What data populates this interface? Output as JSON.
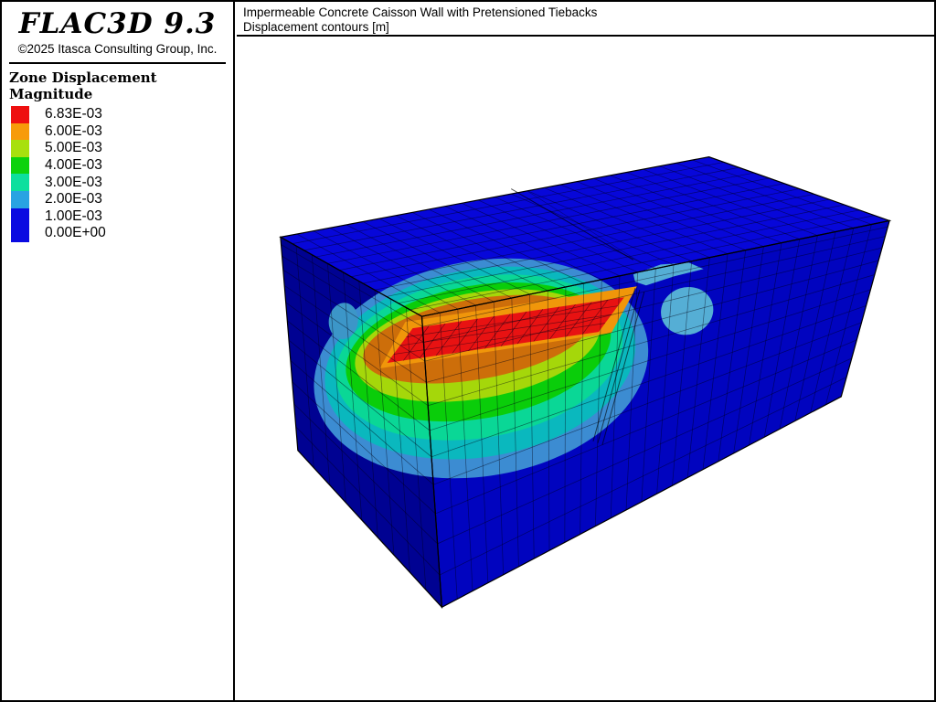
{
  "logo": {
    "title": "FLAC3D 9.3",
    "copyright": "©2025 Itasca Consulting Group, Inc."
  },
  "header": {
    "line1": "Impermeable Concrete Caisson Wall with Pretensioned Tiebacks",
    "line2": "Displacement contours [m]"
  },
  "legend": {
    "title": "Zone Displacement Magnitude",
    "entries": [
      {
        "label": "6.83E-03",
        "color": "#ee1010"
      },
      {
        "label": "6.00E-03",
        "color": "#f79b0a"
      },
      {
        "label": "5.00E-03",
        "color": "#a8e00e"
      },
      {
        "label": "4.00E-03",
        "color": "#0cd20c"
      },
      {
        "label": "3.00E-03",
        "color": "#0cdf9e"
      },
      {
        "label": "2.00E-03",
        "color": "#29a3e2"
      },
      {
        "label": "1.00E-03",
        "color": "#0a0ae1"
      },
      {
        "label": "0.00E+00",
        "color": "#0a0ae1"
      }
    ]
  },
  "scene": {
    "background": "#ffffff",
    "face_colors": {
      "top": "#0707d9",
      "left": "#000292",
      "right": "#0104bf"
    },
    "mesh_color": "rgba(0,0,20,0.5)",
    "edge_color": "#000000",
    "contour_rings": [
      "#3c8cd2",
      "#0ab8be",
      "#0ad796",
      "#0acd0a",
      "#a5d70a",
      "#cd6e0a"
    ],
    "floor_orange": "#f0960a",
    "floor_red": "#e81212",
    "surface_patch": "#55aed5"
  }
}
